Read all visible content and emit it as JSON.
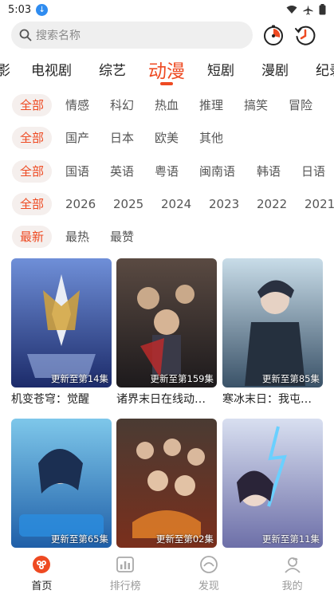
{
  "status_bar": {
    "time": "5:03"
  },
  "search": {
    "placeholder": "搜索名称"
  },
  "category_tabs": [
    {
      "label": "影"
    },
    {
      "label": "电视剧"
    },
    {
      "label": "综艺"
    },
    {
      "label": "动漫",
      "active": true
    },
    {
      "label": "短剧"
    },
    {
      "label": "漫剧"
    },
    {
      "label": "纪录"
    }
  ],
  "filters": {
    "genre": [
      "全部",
      "情感",
      "科幻",
      "热血",
      "推理",
      "搞笑",
      "冒险",
      " "
    ],
    "region": [
      "全部",
      "国产",
      "日本",
      "欧美",
      "其他"
    ],
    "language": [
      "全部",
      "国语",
      "英语",
      "粤语",
      "闽南语",
      "韩语",
      "日语"
    ],
    "year": [
      "全部",
      "2026",
      "2025",
      "2024",
      "2023",
      "2022",
      "2021"
    ],
    "sort": [
      "最新",
      "最热",
      "最赞"
    ]
  },
  "cards": [
    {
      "title": "机变苍穹：觉醒",
      "badge": "更新至第14集"
    },
    {
      "title": "诸界末日在线动…",
      "badge": "更新至第159集"
    },
    {
      "title": "寒冰末日：我屯…",
      "badge": "更新至第85集"
    },
    {
      "title": "",
      "badge": "更新至第65集"
    },
    {
      "title": "",
      "badge": "更新至第02集"
    },
    {
      "title": "",
      "badge": "更新至第11集"
    }
  ],
  "bottom_nav": [
    {
      "label": "首页",
      "icon": "home-icon",
      "active": true
    },
    {
      "label": "排行榜",
      "icon": "ranking-icon"
    },
    {
      "label": "发现",
      "icon": "discover-icon"
    },
    {
      "label": "我的",
      "icon": "profile-icon"
    }
  ],
  "colors": {
    "accent": "#ee4a22",
    "chip_bg": "#f5efed",
    "search_bg": "#efefef"
  }
}
